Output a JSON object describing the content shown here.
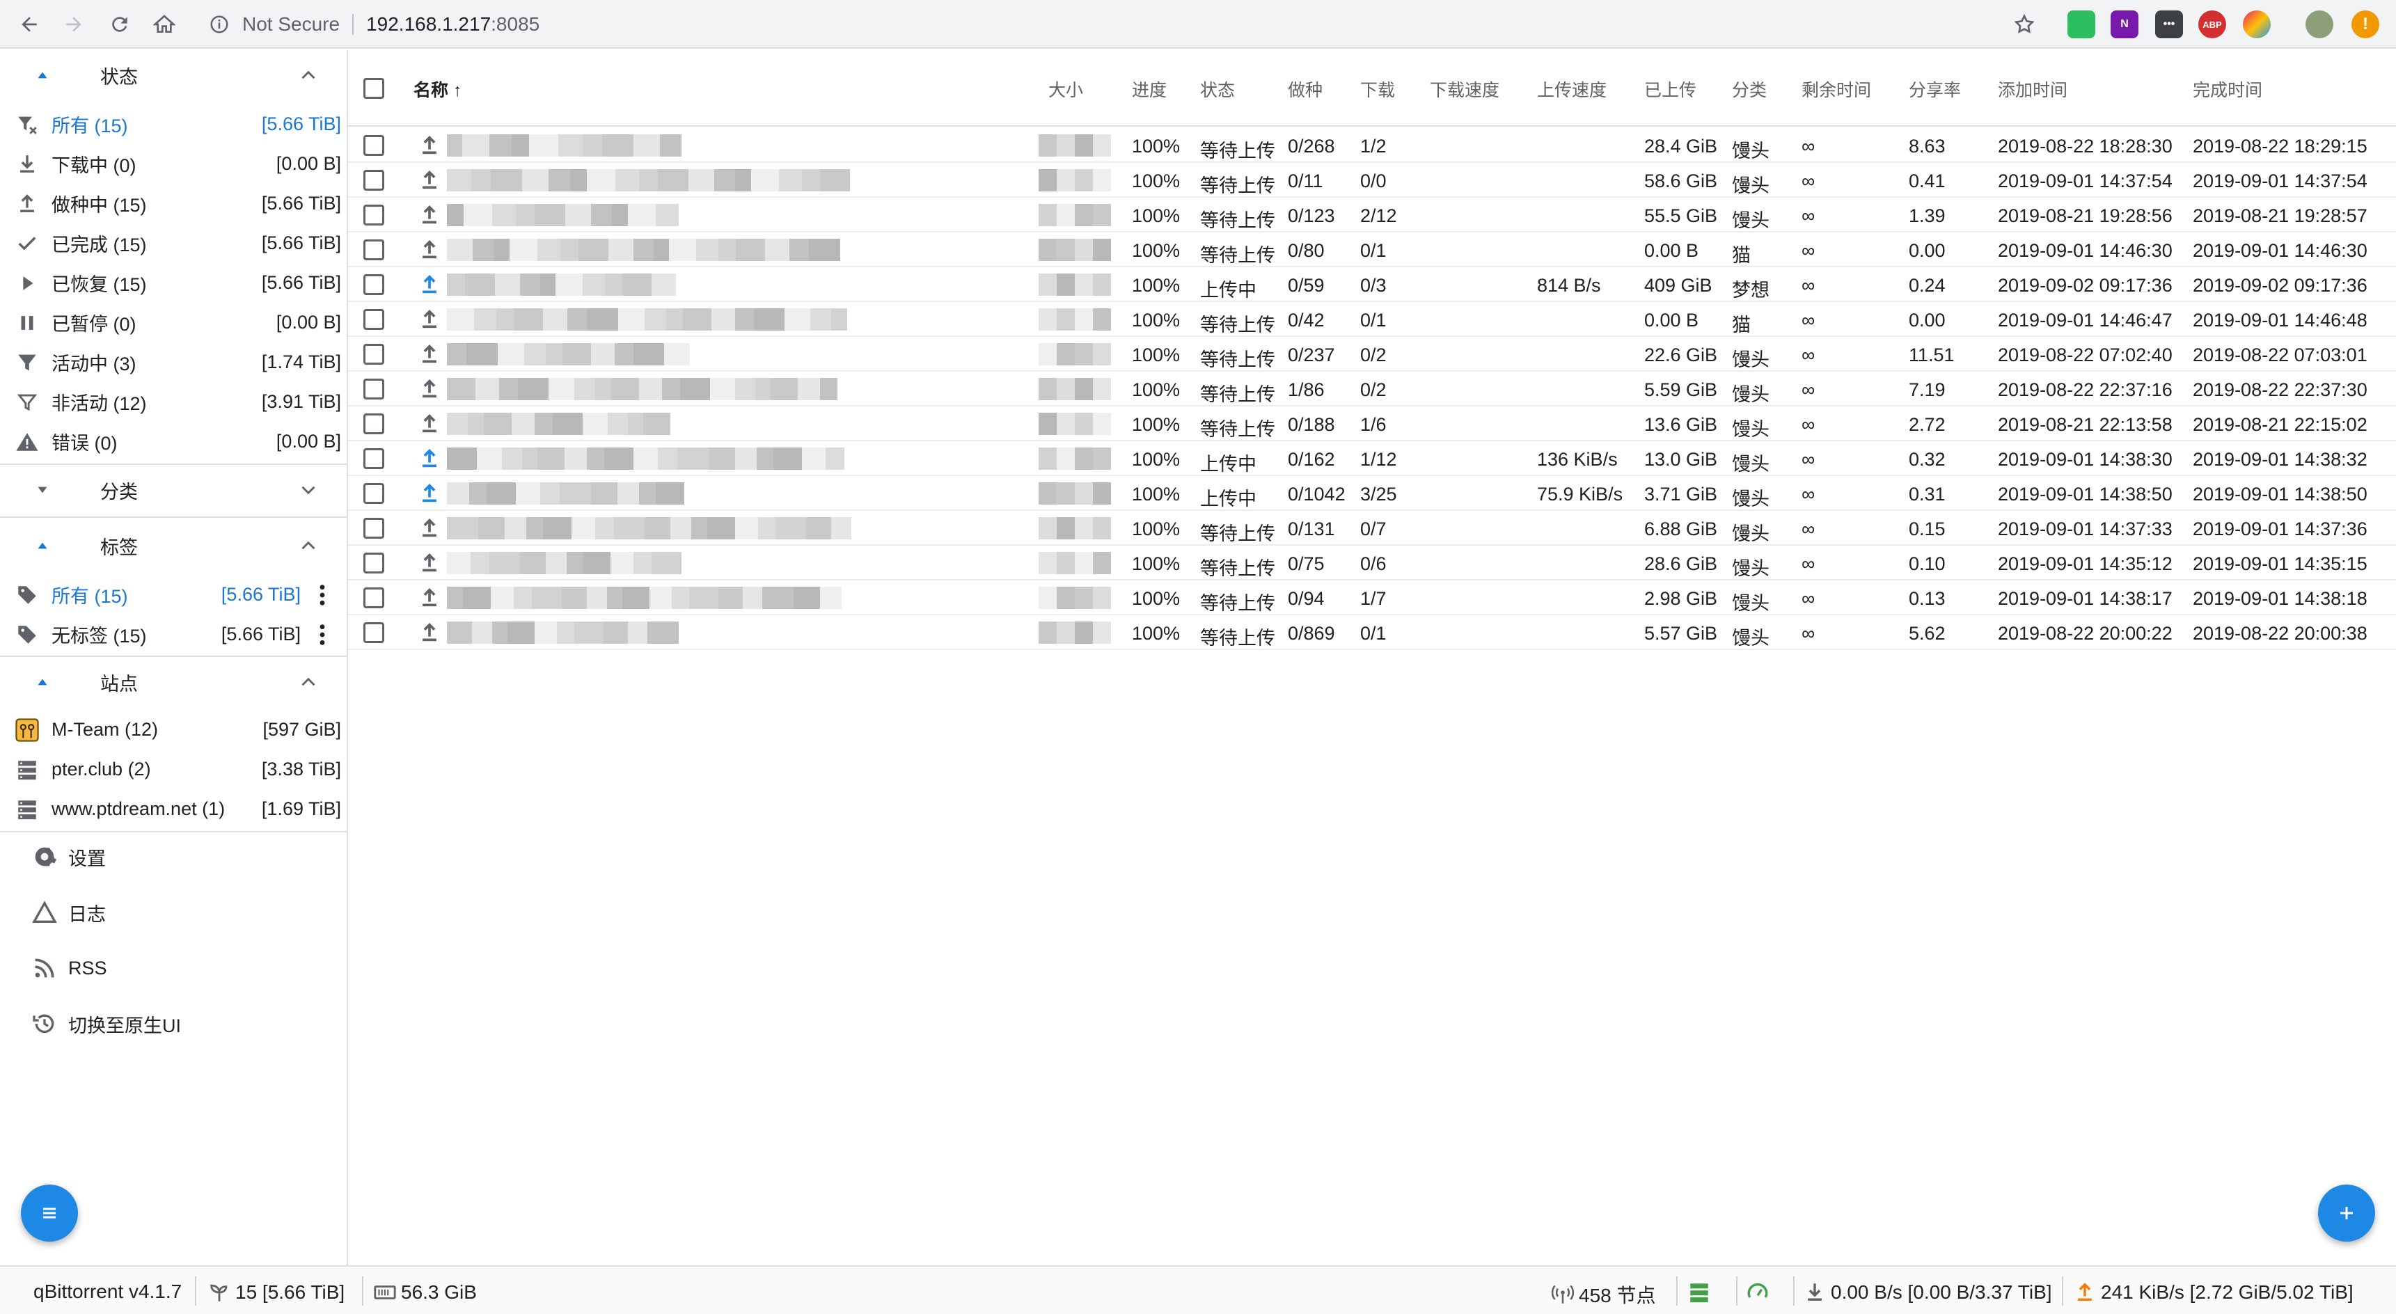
{
  "browser": {
    "security_label": "Not Secure",
    "url_host": "192.168.1.217",
    "url_port": ":8085",
    "extensions": [
      {
        "name": "evernote-icon",
        "color": "#2dbe60"
      },
      {
        "name": "onenote-icon",
        "color": "#7719aa",
        "text": "N"
      },
      {
        "name": "dots-ext-icon",
        "color": "#3c4043",
        "text": "•••"
      },
      {
        "name": "adblock-icon",
        "color": "#d32f2f",
        "text": "ABP"
      },
      {
        "name": "colorful-ext-icon",
        "color": "#e91e63"
      },
      {
        "name": "profile-avatar",
        "color": "#8d9e7a"
      },
      {
        "name": "update-icon",
        "color": "#f29900",
        "text": "!"
      }
    ]
  },
  "sidebar": {
    "status_section": {
      "title": "状态",
      "items": [
        {
          "label": "所有 (15)",
          "value": "[5.66 TiB]",
          "icon": "filter-clear-icon",
          "active": true
        },
        {
          "label": "下载中 (0)",
          "value": "[0.00 B]",
          "icon": "download-icon"
        },
        {
          "label": "做种中 (15)",
          "value": "[5.66 TiB]",
          "icon": "upload-icon"
        },
        {
          "label": "已完成 (15)",
          "value": "[5.66 TiB]",
          "icon": "check-icon"
        },
        {
          "label": "已恢复 (15)",
          "value": "[5.66 TiB]",
          "icon": "play-icon"
        },
        {
          "label": "已暂停 (0)",
          "value": "[0.00 B]",
          "icon": "pause-icon"
        },
        {
          "label": "活动中 (3)",
          "value": "[1.74 TiB]",
          "icon": "filter-icon"
        },
        {
          "label": "非活动 (12)",
          "value": "[3.91 TiB]",
          "icon": "filter-outline-icon"
        },
        {
          "label": "错误 (0)",
          "value": "[0.00 B]",
          "icon": "warning-icon"
        }
      ]
    },
    "category_section": {
      "title": "分类"
    },
    "tags_section": {
      "title": "标签",
      "items": [
        {
          "label": "所有 (15)",
          "value": "[5.66 TiB]",
          "active": true
        },
        {
          "label": "无标签 (15)",
          "value": "[5.66 TiB]"
        }
      ]
    },
    "sites_section": {
      "title": "站点",
      "items": [
        {
          "label": "M-Team (12)",
          "value": "[597 GiB]"
        },
        {
          "label": "pter.club (2)",
          "value": "[3.38 TiB]"
        },
        {
          "label": "www.ptdream.net (1)",
          "value": "[1.69 TiB]"
        }
      ]
    },
    "menu": {
      "settings": "设置",
      "log": "日志",
      "rss": "RSS",
      "switch_ui": "切换至原生UI"
    }
  },
  "table": {
    "headers": {
      "name": "名称",
      "size": "大小",
      "progress": "进度",
      "state": "状态",
      "seeds": "做种",
      "peers": "下载",
      "dl_speed": "下载速度",
      "up_speed": "上传速度",
      "uploaded": "已上传",
      "category": "分类",
      "eta": "剩余时间",
      "ratio": "分享率",
      "added": "添加时间",
      "completed": "完成时间"
    },
    "rows": [
      {
        "progress": "100%",
        "state": "等待上传",
        "seeds": "0/268",
        "peers": "1/2",
        "up_speed": "",
        "uploaded": "28.4 GiB",
        "category": "馒头",
        "eta": "∞",
        "ratio": "8.63",
        "added": "2019-08-22 18:28:30",
        "completed": "2019-08-22 18:29:15",
        "active": false
      },
      {
        "progress": "100%",
        "state": "等待上传",
        "seeds": "0/11",
        "peers": "0/0",
        "up_speed": "",
        "uploaded": "58.6 GiB",
        "category": "馒头",
        "eta": "∞",
        "ratio": "0.41",
        "added": "2019-09-01 14:37:54",
        "completed": "2019-09-01 14:37:54",
        "active": false
      },
      {
        "progress": "100%",
        "state": "等待上传",
        "seeds": "0/123",
        "peers": "2/12",
        "up_speed": "",
        "uploaded": "55.5 GiB",
        "category": "馒头",
        "eta": "∞",
        "ratio": "1.39",
        "added": "2019-08-21 19:28:56",
        "completed": "2019-08-21 19:28:57",
        "active": false
      },
      {
        "progress": "100%",
        "state": "等待上传",
        "seeds": "0/80",
        "peers": "0/1",
        "up_speed": "",
        "uploaded": "0.00 B",
        "category": "猫",
        "eta": "∞",
        "ratio": "0.00",
        "added": "2019-09-01 14:46:30",
        "completed": "2019-09-01 14:46:30",
        "active": false
      },
      {
        "progress": "100%",
        "state": "上传中",
        "seeds": "0/59",
        "peers": "0/3",
        "up_speed": "814 B/s",
        "uploaded": "409 GiB",
        "category": "梦想",
        "eta": "∞",
        "ratio": "0.24",
        "added": "2019-09-02 09:17:36",
        "completed": "2019-09-02 09:17:36",
        "active": true
      },
      {
        "progress": "100%",
        "state": "等待上传",
        "seeds": "0/42",
        "peers": "0/1",
        "up_speed": "",
        "uploaded": "0.00 B",
        "category": "猫",
        "eta": "∞",
        "ratio": "0.00",
        "added": "2019-09-01 14:46:47",
        "completed": "2019-09-01 14:46:48",
        "active": false
      },
      {
        "progress": "100%",
        "state": "等待上传",
        "seeds": "0/237",
        "peers": "0/2",
        "up_speed": "",
        "uploaded": "22.6 GiB",
        "category": "馒头",
        "eta": "∞",
        "ratio": "11.51",
        "added": "2019-08-22 07:02:40",
        "completed": "2019-08-22 07:03:01",
        "active": false
      },
      {
        "progress": "100%",
        "state": "等待上传",
        "seeds": "1/86",
        "peers": "0/2",
        "up_speed": "",
        "uploaded": "5.59 GiB",
        "category": "馒头",
        "eta": "∞",
        "ratio": "7.19",
        "added": "2019-08-22 22:37:16",
        "completed": "2019-08-22 22:37:30",
        "active": false
      },
      {
        "progress": "100%",
        "state": "等待上传",
        "seeds": "0/188",
        "peers": "1/6",
        "up_speed": "",
        "uploaded": "13.6 GiB",
        "category": "馒头",
        "eta": "∞",
        "ratio": "2.72",
        "added": "2019-08-21 22:13:58",
        "completed": "2019-08-21 22:15:02",
        "active": false
      },
      {
        "progress": "100%",
        "state": "上传中",
        "seeds": "0/162",
        "peers": "1/12",
        "up_speed": "136 KiB/s",
        "uploaded": "13.0 GiB",
        "category": "馒头",
        "eta": "∞",
        "ratio": "0.32",
        "added": "2019-09-01 14:38:30",
        "completed": "2019-09-01 14:38:32",
        "active": true
      },
      {
        "progress": "100%",
        "state": "上传中",
        "seeds": "0/1042",
        "peers": "3/25",
        "up_speed": "75.9 KiB/s",
        "uploaded": "3.71 GiB",
        "category": "馒头",
        "eta": "∞",
        "ratio": "0.31",
        "added": "2019-09-01 14:38:50",
        "completed": "2019-09-01 14:38:50",
        "active": true
      },
      {
        "progress": "100%",
        "state": "等待上传",
        "seeds": "0/131",
        "peers": "0/7",
        "up_speed": "",
        "uploaded": "6.88 GiB",
        "category": "馒头",
        "eta": "∞",
        "ratio": "0.15",
        "added": "2019-09-01 14:37:33",
        "completed": "2019-09-01 14:37:36",
        "active": false
      },
      {
        "progress": "100%",
        "state": "等待上传",
        "seeds": "0/75",
        "peers": "0/6",
        "up_speed": "",
        "uploaded": "28.6 GiB",
        "category": "馒头",
        "eta": "∞",
        "ratio": "0.10",
        "added": "2019-09-01 14:35:12",
        "completed": "2019-09-01 14:35:15",
        "active": false
      },
      {
        "progress": "100%",
        "state": "等待上传",
        "seeds": "0/94",
        "peers": "1/7",
        "up_speed": "",
        "uploaded": "2.98 GiB",
        "category": "馒头",
        "eta": "∞",
        "ratio": "0.13",
        "added": "2019-09-01 14:38:17",
        "completed": "2019-09-01 14:38:18",
        "active": false
      },
      {
        "progress": "100%",
        "state": "等待上传",
        "seeds": "0/869",
        "peers": "0/1",
        "up_speed": "",
        "uploaded": "5.57 GiB",
        "category": "馒头",
        "eta": "∞",
        "ratio": "5.62",
        "added": "2019-08-22 20:00:22",
        "completed": "2019-08-22 20:00:38",
        "active": false
      }
    ]
  },
  "statusbar": {
    "version": "qBittorrent v4.1.7",
    "torrents": "15 [5.66 TiB]",
    "free_space": "56.3 GiB",
    "dht_nodes": "458 节点",
    "download": "0.00 B/s [0.00 B/3.37 TiB]",
    "upload": "241 KiB/s [2.72 GiB/5.02 TiB]"
  },
  "colors": {
    "accent": "#1976d2",
    "upload_active": "#1e88e5",
    "upload_idle": "#5f6368"
  }
}
